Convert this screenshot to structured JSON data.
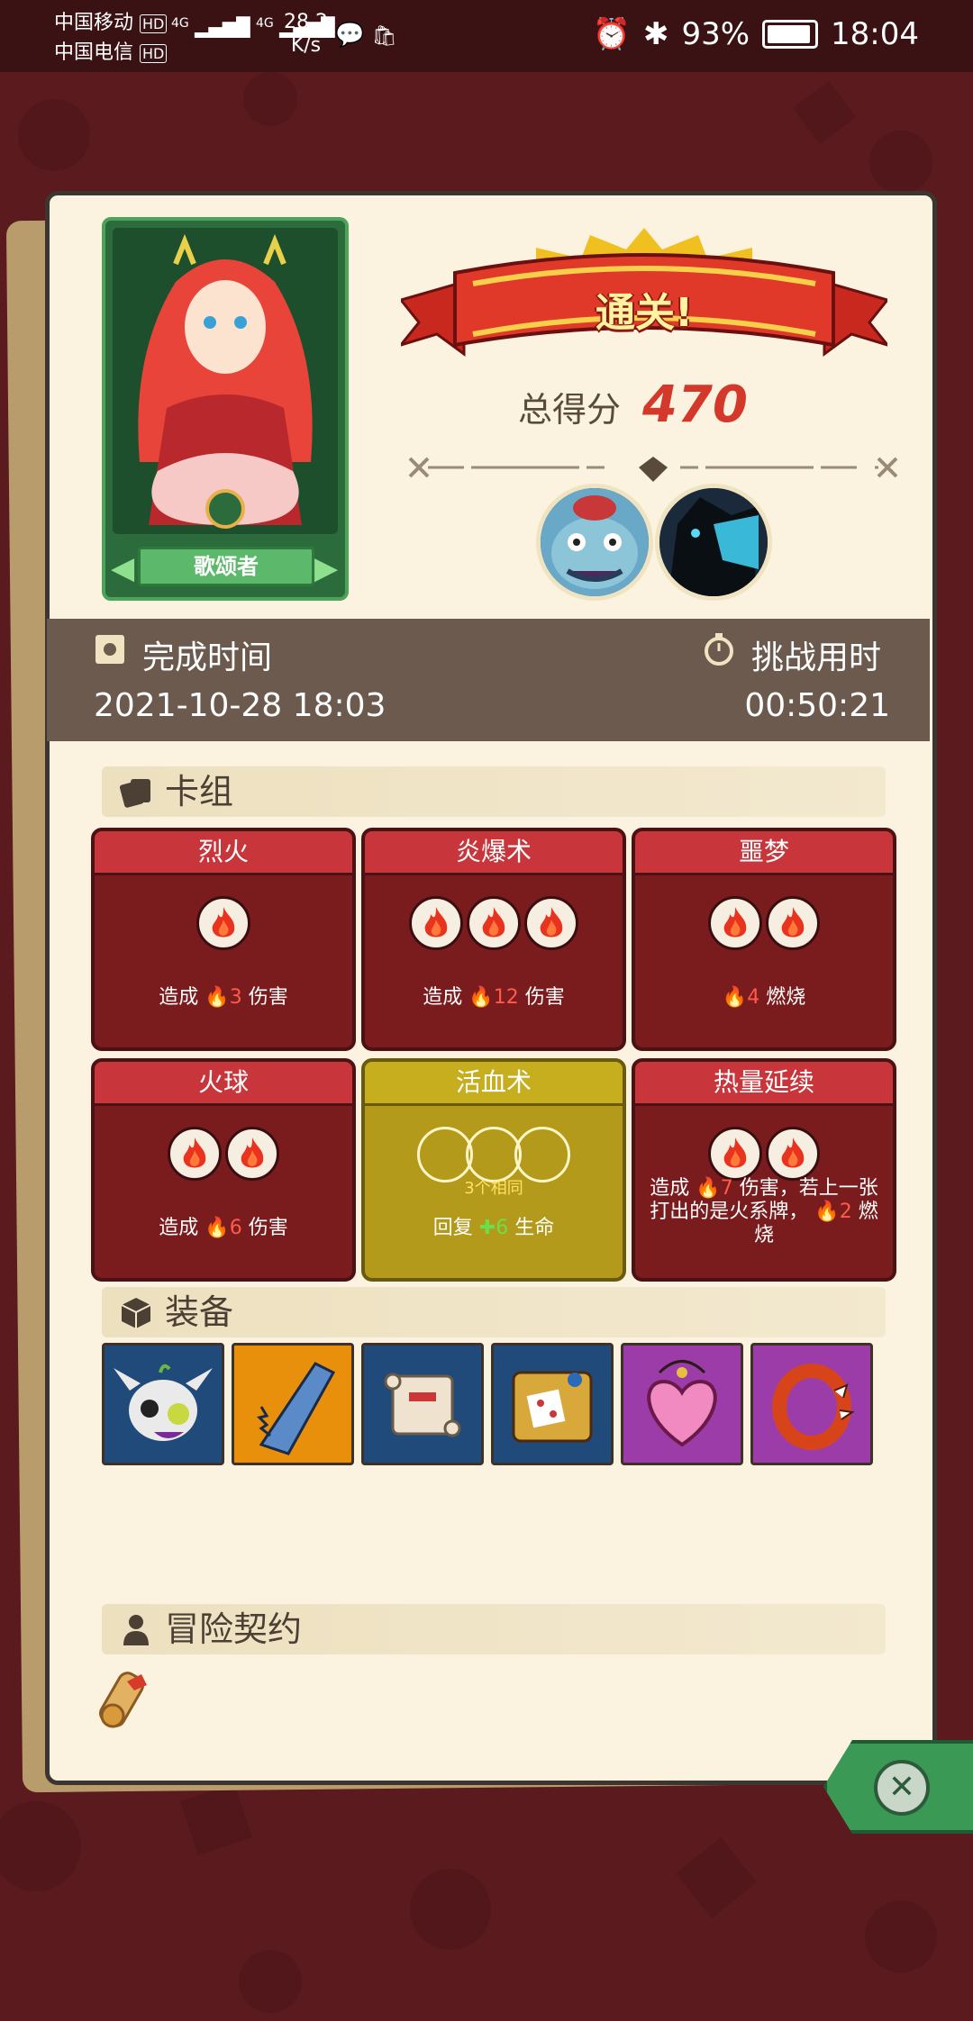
{
  "status_bar": {
    "carrier1": "中国移动",
    "carrier1_badge": "HD",
    "carrier2": "中国电信",
    "carrier2_badge": "HD",
    "network1": "4G",
    "network2": "4G",
    "speed_value": "28.2",
    "speed_unit": "K/s",
    "battery": "93%",
    "battery_level": 0.93,
    "time": "18:04"
  },
  "hero": {
    "name": "歌颂者"
  },
  "result": {
    "banner": "通关!",
    "score_label": "总得分",
    "score_value": "470"
  },
  "stats": {
    "finish_label": "完成时间",
    "finish_value": "2021-10-28 18:03",
    "duration_label": "挑战用时",
    "duration_value": "00:50:21"
  },
  "deck": {
    "title": "卡组",
    "cards": [
      {
        "name": "烈火",
        "orbs": 1,
        "desc_pre": "造成",
        "num": "3",
        "desc_post": "伤害"
      },
      {
        "name": "炎爆术",
        "orbs": 3,
        "desc_pre": "造成",
        "num": "12",
        "desc_post": "伤害"
      },
      {
        "name": "噩梦",
        "orbs": 2,
        "desc_pre": "",
        "num": "4",
        "desc_post": "燃烧"
      },
      {
        "name": "火球",
        "orbs": 2,
        "desc_pre": "造成",
        "num": "6",
        "desc_post": "伤害"
      },
      {
        "name": "活血术",
        "orbs": 3,
        "same_tag": "3个相同",
        "desc_pre": "回复",
        "num": "6",
        "desc_post": "生命"
      },
      {
        "name": "热量延续",
        "orbs": 2,
        "desc_line1_pre": "造成",
        "desc_line1_num": "7",
        "desc_line1_post": "伤害，若上一张",
        "desc_line2_pre": "打出的是火系牌，",
        "desc_line2_num": "2",
        "desc_line2_post": "燃",
        "desc_line3": "烧"
      }
    ]
  },
  "equipment": {
    "title": "装备",
    "items": [
      {
        "icon": "horned-skull-icon",
        "bg": "#1f4a7a"
      },
      {
        "icon": "blue-saw-blade-icon",
        "bg": "#e8900c"
      },
      {
        "icon": "scroll-icon",
        "bg": "#1f4a7a"
      },
      {
        "icon": "dice-chest-icon",
        "bg": "#1f4a7a"
      },
      {
        "icon": "heart-pendant-icon",
        "bg": "#9c3ca8"
      },
      {
        "icon": "spiked-bracelet-icon",
        "bg": "#9c3ca8"
      }
    ]
  },
  "contract": {
    "title": "冒险契约"
  },
  "colors": {
    "accent_red": "#d4382b",
    "card_red": "#7a1c1d",
    "card_gold": "#b49a1a",
    "band": "#6b5a4d"
  }
}
